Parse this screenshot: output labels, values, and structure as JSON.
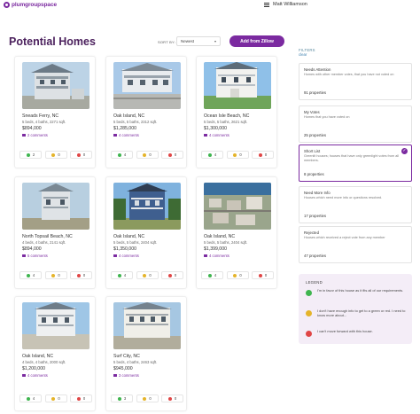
{
  "app": {
    "logo_text": "plumgroupspace",
    "user_name": "Matt Williamson"
  },
  "header": {
    "title": "Potential Homes",
    "sort_label": "SORT BY:",
    "sort_value": "Newest",
    "add_button": "Add from Zillow"
  },
  "listings": [
    {
      "location": "Sneads Ferry, NC",
      "details": "5 beds, 4 baths, 2271 sqft.",
      "price": "$894,000",
      "comments": "2 comments",
      "votes": {
        "yes": "2",
        "maybe": "0",
        "no": "0"
      }
    },
    {
      "location": "Oak Island, NC",
      "details": "5 beds, 5 baths, 2312 sqft.",
      "price": "$1,285,000",
      "comments": "4 comments",
      "votes": {
        "yes": "4",
        "maybe": "0",
        "no": "0"
      }
    },
    {
      "location": "Ocean Isle Beach, NC",
      "details": "5 beds, 5 baths, 2621 sqft.",
      "price": "$1,300,000",
      "comments": "4 comments",
      "votes": {
        "yes": "4",
        "maybe": "0",
        "no": "0"
      }
    },
    {
      "location": "North Topsail Beach, NC",
      "details": "4 beds, 4 baths, 2141 sqft.",
      "price": "$894,000",
      "comments": "5 comments",
      "votes": {
        "yes": "4",
        "maybe": "0",
        "no": "0"
      }
    },
    {
      "location": "Oak Island, NC",
      "details": "5 beds, 5 baths, 2404 sqft.",
      "price": "$1,350,000",
      "comments": "4 comments",
      "votes": {
        "yes": "4",
        "maybe": "0",
        "no": "0"
      }
    },
    {
      "location": "Oak Island, NC",
      "details": "5 beds, 5 baths, 2404 sqft.",
      "price": "$1,399,000",
      "comments": "4 comments",
      "votes": {
        "yes": "4",
        "maybe": "0",
        "no": "0"
      }
    },
    {
      "location": "Oak Island, NC",
      "details": "4 beds, 4 baths, 2000 sqft.",
      "price": "$1,200,000",
      "comments": "4 comments",
      "votes": {
        "yes": "4",
        "maybe": "0",
        "no": "0"
      }
    },
    {
      "location": "Surf City, NC",
      "details": "5 beds, 4 baths, 2463 sqft.",
      "price": "$945,000",
      "comments": "3 comments",
      "votes": {
        "yes": "3",
        "maybe": "0",
        "no": "0"
      }
    }
  ],
  "filters": {
    "label": "FILTERS",
    "clear": "clear",
    "items": [
      {
        "title": "Needs Attention",
        "description": "Homes with other member votes, that you have not voted on",
        "count": "91 properties"
      },
      {
        "title": "My Votes",
        "description": "Homes that you have voted on",
        "count": "25 properties"
      },
      {
        "title": "Short List",
        "description": "Greenlit houses; houses that have only greenlight votes from all members.",
        "count": "8 properties"
      },
      {
        "title": "Need More Info",
        "description": "Houses which need more info or questions resolved.",
        "count": "17 properties"
      },
      {
        "title": "Rejected",
        "description": "Houses which received a reject vote from any member",
        "count": "47 properties"
      }
    ]
  },
  "legend": {
    "title": "LEGEND",
    "items": [
      {
        "text": "I'm in favor of this house as it fits all of our requirements."
      },
      {
        "text": "I don't have enough info to get to a green or red. I need to know more about..."
      },
      {
        "text": "I can't move forward with this house."
      }
    ]
  },
  "colors": {
    "accent": "#7b2aa0",
    "title": "#4a1f5c",
    "yes": "#3fb54f",
    "maybe": "#e5b42a",
    "no": "#e04646"
  }
}
